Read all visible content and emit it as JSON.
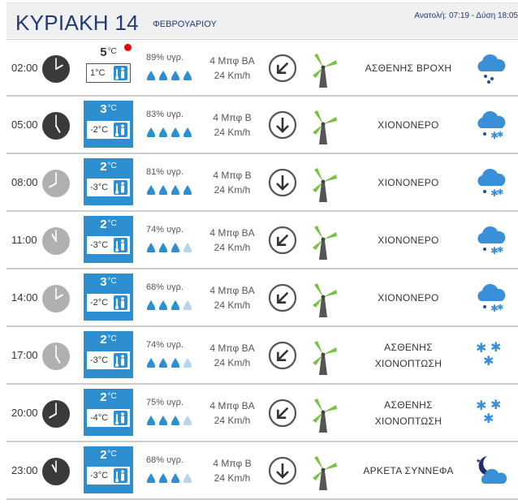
{
  "header": {
    "day": "ΚΥΡΙΑΚΗ 14",
    "month": "ΦΕΒΡΟΥΑΡΙΟΥ",
    "sun": "Ανατολή: 07:19  - Δύση 18:05"
  },
  "colors": {
    "accent": "#2d8fcf",
    "title": "#223a78",
    "drop_full": "#2d8fcf",
    "drop_empty": "#b8d4ea",
    "turbine_blade": "#7ac142"
  },
  "rows": [
    {
      "time": "02:00",
      "clock": "dark-clock-icon",
      "clock_hour": 2,
      "temp": "5",
      "unit": "°C",
      "feels": "1°C",
      "box": "white",
      "alert": true,
      "humidity": "89% υγρ.",
      "drops": 4,
      "wind": "4 Μπφ ΒΑ",
      "speed": "24 Km/h",
      "arrow": "down-left",
      "cond": "ΑΣΘΕΝΗΣ ΒΡΟΧΗ",
      "icon": "rain-cloud-icon"
    },
    {
      "time": "05:00",
      "clock": "dark-clock-icon",
      "clock_hour": 5,
      "temp": "3",
      "unit": "°C",
      "feels": "-2°C",
      "box": "blue",
      "alert": false,
      "humidity": "83% υγρ.",
      "drops": 4,
      "wind": "4 Μπφ Β",
      "speed": "24 Km/h",
      "arrow": "down",
      "cond": "ΧΙΟΝΟΝΕΡΟ",
      "icon": "sleet-cloud-icon"
    },
    {
      "time": "08:00",
      "clock": "light-clock-icon",
      "clock_hour": 8,
      "temp": "2",
      "unit": "°C",
      "feels": "-3°C",
      "box": "blue",
      "alert": false,
      "humidity": "81% υγρ.",
      "drops": 4,
      "wind": "4 Μπφ Β",
      "speed": "24 Km/h",
      "arrow": "down",
      "cond": "ΧΙΟΝΟΝΕΡΟ",
      "icon": "sleet-cloud-icon"
    },
    {
      "time": "11:00",
      "clock": "light-clock-icon",
      "clock_hour": 11,
      "temp": "2",
      "unit": "°C",
      "feels": "-3°C",
      "box": "blue",
      "alert": false,
      "humidity": "74% υγρ.",
      "drops": 3,
      "wind": "4 Μπφ ΒΑ",
      "speed": "24 Km/h",
      "arrow": "down-left",
      "cond": "ΧΙΟΝΟΝΕΡΟ",
      "icon": "sleet-cloud-icon"
    },
    {
      "time": "14:00",
      "clock": "light-clock-icon",
      "clock_hour": 2,
      "temp": "3",
      "unit": "°C",
      "feels": "-2°C",
      "box": "blue",
      "alert": false,
      "humidity": "68% υγρ.",
      "drops": 3,
      "wind": "4 Μπφ ΒΑ",
      "speed": "24 Km/h",
      "arrow": "down-left",
      "cond": "ΧΙΟΝΟΝΕΡΟ",
      "icon": "sleet-cloud-icon"
    },
    {
      "time": "17:00",
      "clock": "light-clock-icon",
      "clock_hour": 5,
      "temp": "2",
      "unit": "°C",
      "feels": "-3°C",
      "box": "blue",
      "alert": false,
      "humidity": "74% υγρ.",
      "drops": 3,
      "wind": "4 Μπφ ΒΑ",
      "speed": "24 Km/h",
      "arrow": "down-left",
      "cond": "ΑΣΘΕΝΗΣ\nΧΙΟΝΟΠΤΩΣΗ",
      "icon": "snowflakes-icon"
    },
    {
      "time": "20:00",
      "clock": "dark-clock-icon",
      "clock_hour": 8,
      "temp": "2",
      "unit": "°C",
      "feels": "-4°C",
      "box": "blue",
      "alert": false,
      "humidity": "75% υγρ.",
      "drops": 3,
      "wind": "4 Μπφ ΒΑ",
      "speed": "24 Km/h",
      "arrow": "down-left",
      "cond": "ΑΣΘΕΝΗΣ\nΧΙΟΝΟΠΤΩΣΗ",
      "icon": "snowflakes-icon"
    },
    {
      "time": "23:00",
      "clock": "dark-clock-icon",
      "clock_hour": 11,
      "temp": "2",
      "unit": "°C",
      "feels": "-3°C",
      "box": "blue",
      "alert": false,
      "humidity": "68% υγρ.",
      "drops": 3,
      "wind": "4 Μπφ Β",
      "speed": "24 Km/h",
      "arrow": "down",
      "cond": "ΑΡΚΕΤΑ ΣΥΝΝΕΦΑ",
      "icon": "moon-cloud-icon"
    }
  ]
}
